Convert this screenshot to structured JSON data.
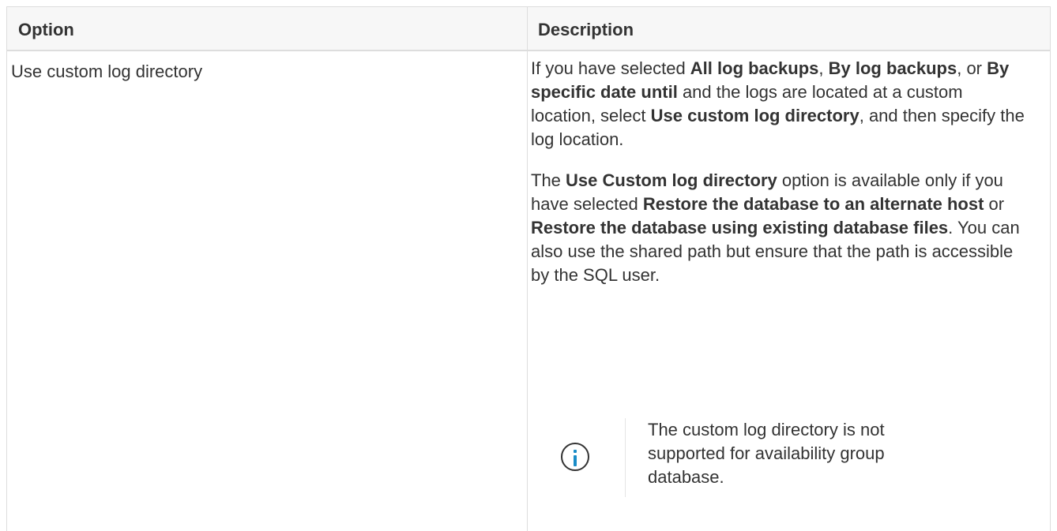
{
  "table": {
    "headers": {
      "option": "Option",
      "description": "Description"
    },
    "row": {
      "option": "Use custom log directory",
      "paragraph1": [
        {
          "t": "If you have selected ",
          "b": false
        },
        {
          "t": "All log backups",
          "b": true
        },
        {
          "t": ", ",
          "b": false
        },
        {
          "t": "By log backups",
          "b": true
        },
        {
          "t": ", or ",
          "b": false
        },
        {
          "t": "By specific date until",
          "b": true
        },
        {
          "t": " and the logs are located at a custom location, select ",
          "b": false
        },
        {
          "t": "Use custom log directory",
          "b": true
        },
        {
          "t": ", and then specify the log location.",
          "b": false
        }
      ],
      "paragraph2": [
        {
          "t": "The ",
          "b": false
        },
        {
          "t": "Use Custom log directory",
          "b": true
        },
        {
          "t": " option is available only if you have selected ",
          "b": false
        },
        {
          "t": "Restore the database to an alternate host",
          "b": true
        },
        {
          "t": " or ",
          "b": false
        },
        {
          "t": "Restore the database using existing database files",
          "b": true
        },
        {
          "t": ". You can also use the shared path but ensure that the path is accessible by the SQL user.",
          "b": false
        }
      ],
      "note": {
        "icon": "info-icon",
        "text": "The custom log directory is not supported for availability group database."
      }
    }
  }
}
